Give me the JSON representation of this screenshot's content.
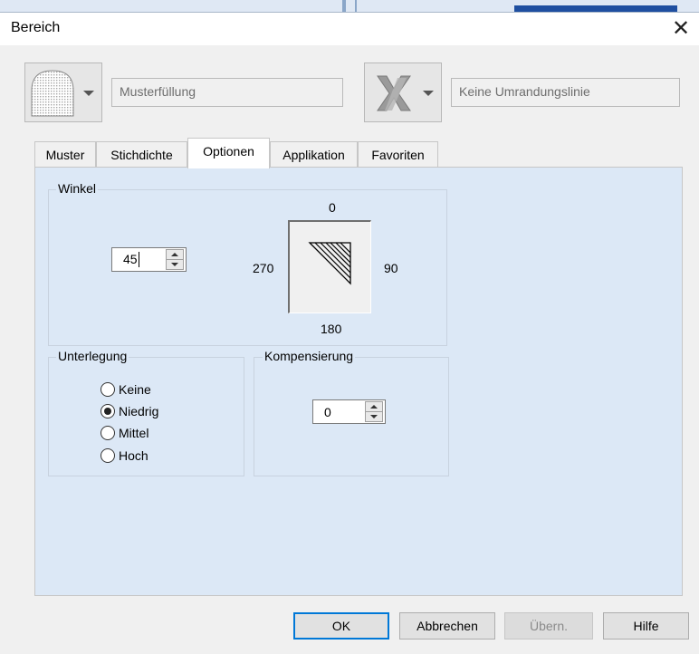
{
  "dialog": {
    "title": "Bereich"
  },
  "toolbar": {
    "fill_type_value": "Musterfüllung",
    "border_type_value": "Keine Umrandungslinie"
  },
  "tabs": [
    {
      "label": "Muster",
      "active": false
    },
    {
      "label": "Stichdichte",
      "active": false
    },
    {
      "label": "Optionen",
      "active": true
    },
    {
      "label": "Applikation",
      "active": false
    },
    {
      "label": "Favoriten",
      "active": false
    }
  ],
  "angle": {
    "group_label": "Winkel",
    "value": "45",
    "label_top": "0",
    "label_right": "90",
    "label_bottom": "180",
    "label_left": "270"
  },
  "underlay": {
    "group_label": "Unterlegung",
    "options": [
      {
        "label": "Keine",
        "checked": false
      },
      {
        "label": "Niedrig",
        "checked": true
      },
      {
        "label": "Mittel",
        "checked": false
      },
      {
        "label": "Hoch",
        "checked": false
      }
    ]
  },
  "compensation": {
    "group_label": "Kompensierung",
    "value": "0"
  },
  "buttons": {
    "ok": "OK",
    "cancel": "Abbrechen",
    "apply": "Übern.",
    "help": "Hilfe"
  },
  "icons": {
    "close": "close-icon",
    "fill": "pattern-fill-icon",
    "border": "no-border-icon"
  }
}
